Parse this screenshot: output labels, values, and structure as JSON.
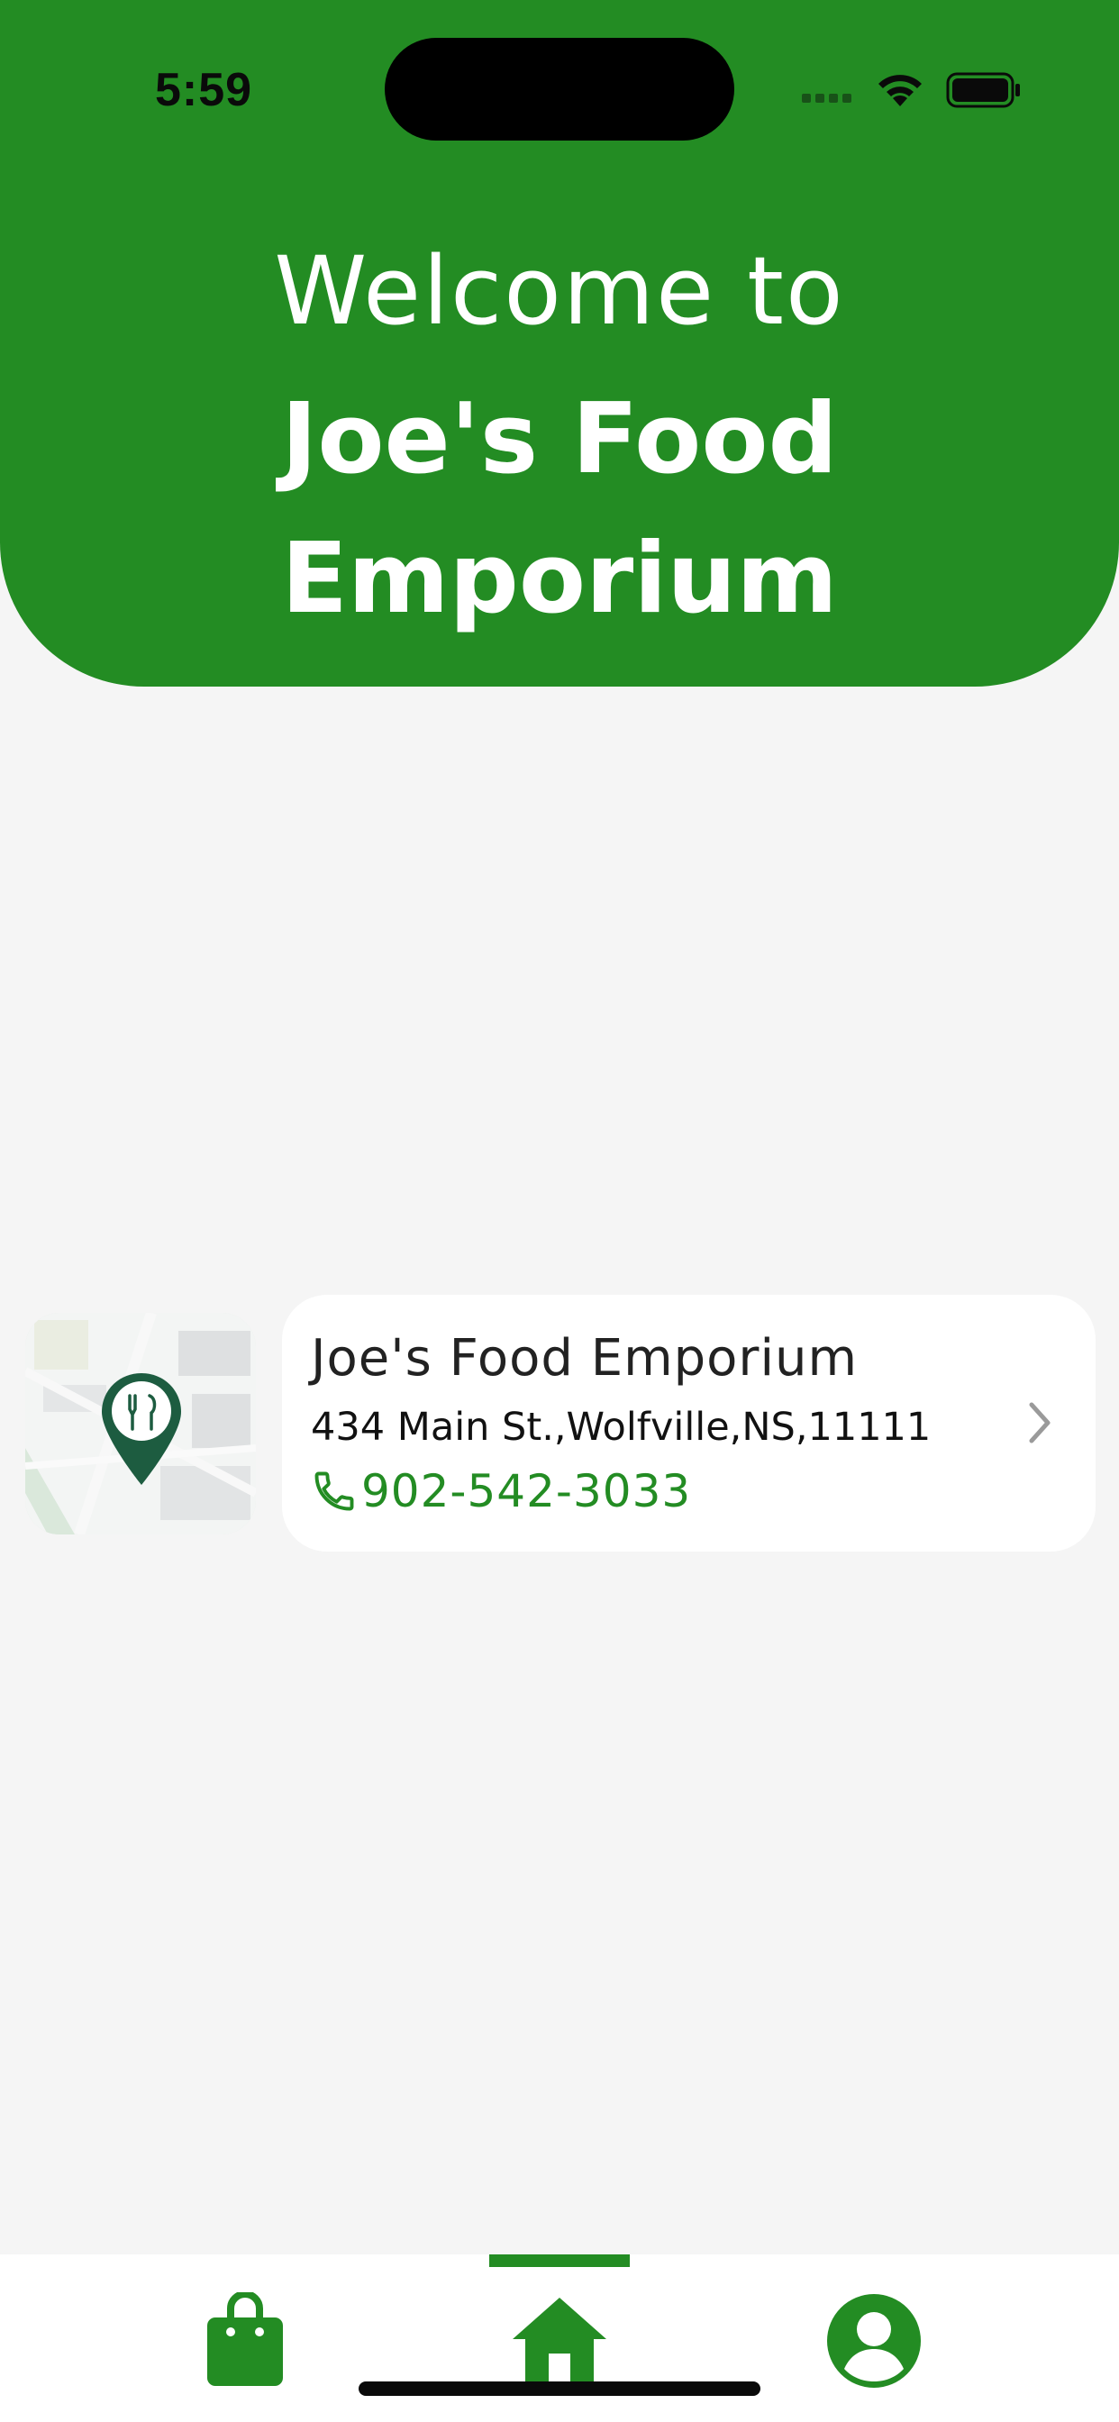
{
  "status_bar": {
    "time": "5:59"
  },
  "header": {
    "welcome": "Welcome to",
    "brand": "Joe's Food Emporium"
  },
  "restaurant": {
    "name": "Joe's Food Emporium",
    "address": "434 Main St.,Wolfville,NS,11111",
    "phone": "902-542-3033"
  },
  "bottom_nav": {
    "items": [
      {
        "icon": "shopping-bag-icon",
        "active": false
      },
      {
        "icon": "home-icon",
        "active": true
      },
      {
        "icon": "account-icon",
        "active": false
      }
    ]
  },
  "colors": {
    "brand_green": "#238c23",
    "pin_green": "#1d5c40",
    "background": "#f5f5f5"
  }
}
